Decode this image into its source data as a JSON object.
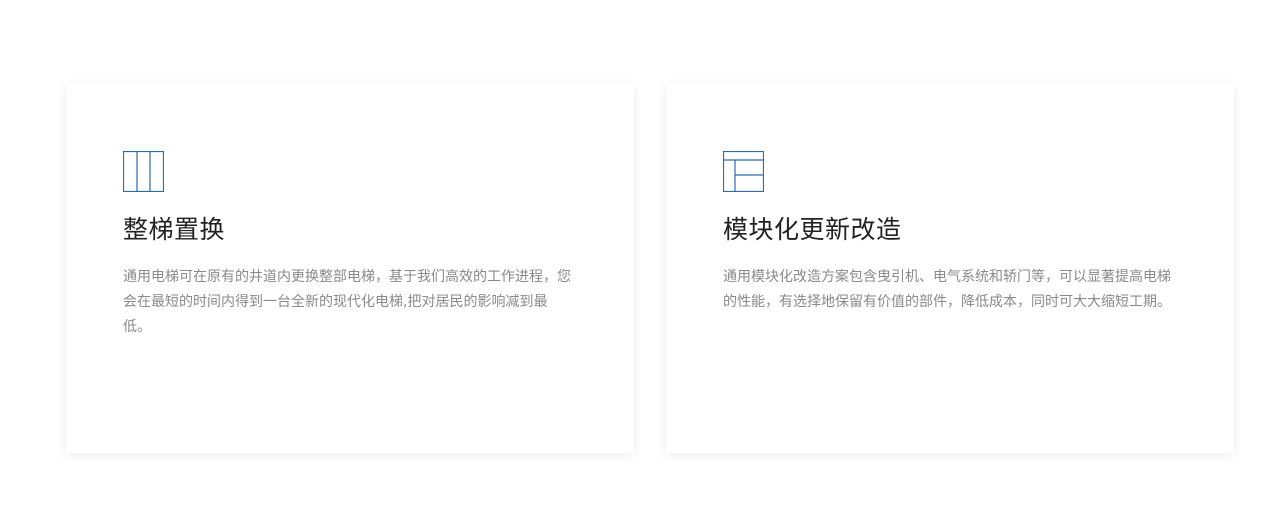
{
  "colors": {
    "icon_accent": "#2b6cb0",
    "title": "#222222",
    "description": "#8a8a8a"
  },
  "cards": [
    {
      "icon": "columns-icon",
      "title": "整梯置换",
      "description": "通用电梯可在原有的井道内更换整部电梯，基于我们高效的工作进程，您会在最短的时间内得到一台全新的现代化电梯,把对居民的影响减到最低。"
    },
    {
      "icon": "layout-panels-icon",
      "title": "模块化更新改造",
      "description": "通用模块化改造方案包含曳引机、电气系统和轿门等，可以显著提高电梯的性能，有选择地保留有价值的部件，降低成本，同时可大大缩短工期。"
    }
  ]
}
